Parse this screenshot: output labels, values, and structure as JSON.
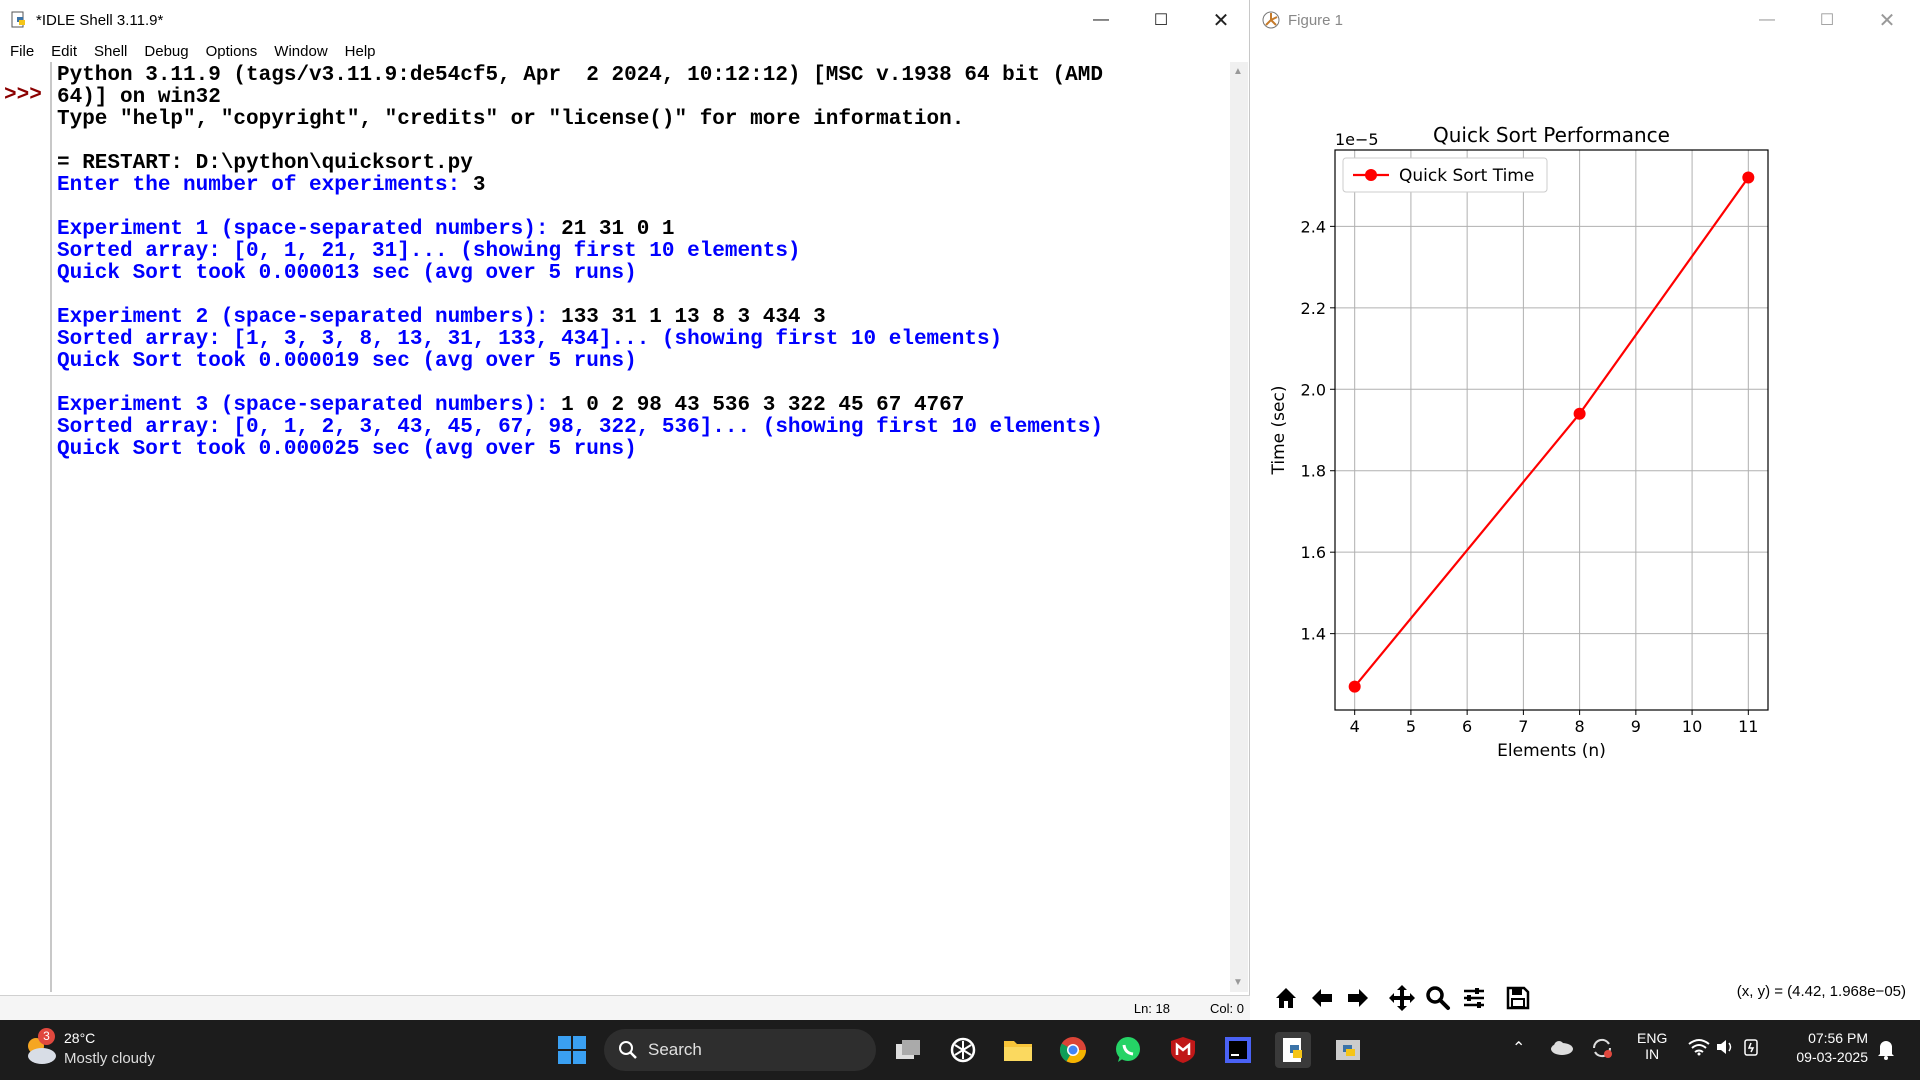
{
  "idle": {
    "title": "*IDLE Shell 3.11.9*",
    "menu": [
      "File",
      "Edit",
      "Shell",
      "Debug",
      "Options",
      "Window",
      "Help"
    ],
    "prompt": ">>>",
    "lines": [
      [
        {
          "t": "Python 3.11.9 (tags/v3.11.9:de54cf5, Apr  2 2024, 10:12:12) [MSC v.1938 64 bit (AMD",
          "c": "blk"
        }
      ],
      [
        {
          "t": "64)] on win32",
          "c": "blk"
        }
      ],
      [
        {
          "t": "Type \"help\", \"copyright\", \"credits\" or \"license()\" for more information.",
          "c": "blk"
        }
      ],
      [
        {
          "t": "",
          "c": "blk"
        }
      ],
      [
        {
          "t": "= RESTART: D:\\python\\quicksort.py",
          "c": "blk"
        }
      ],
      [
        {
          "t": "Enter the number of experiments: ",
          "c": "blue"
        },
        {
          "t": "3",
          "c": "blk"
        }
      ],
      [
        {
          "t": "",
          "c": "blk"
        }
      ],
      [
        {
          "t": "Experiment 1 (space-separated numbers): ",
          "c": "blue"
        },
        {
          "t": "21 31 0 1",
          "c": "blk"
        }
      ],
      [
        {
          "t": "Sorted array: [0, 1, 21, 31]... (showing first 10 elements)",
          "c": "blue"
        }
      ],
      [
        {
          "t": "Quick Sort took 0.000013 sec (avg over 5 runs)",
          "c": "blue"
        }
      ],
      [
        {
          "t": "",
          "c": "blk"
        }
      ],
      [
        {
          "t": "Experiment 2 (space-separated numbers): ",
          "c": "blue"
        },
        {
          "t": "133 31 1 13 8 3 434 3",
          "c": "blk"
        }
      ],
      [
        {
          "t": "Sorted array: [1, 3, 3, 8, 13, 31, 133, 434]... (showing first 10 elements)",
          "c": "blue"
        }
      ],
      [
        {
          "t": "Quick Sort took 0.000019 sec (avg over 5 runs)",
          "c": "blue"
        }
      ],
      [
        {
          "t": "",
          "c": "blk"
        }
      ],
      [
        {
          "t": "Experiment 3 (space-separated numbers): ",
          "c": "blue"
        },
        {
          "t": "1 0 2 98 43 536 3 322 45 67 4767",
          "c": "blk"
        }
      ],
      [
        {
          "t": "Sorted array: [0, 1, 2, 3, 43, 45, 67, 98, 322, 536]... (showing first 10 elements)",
          "c": "blue"
        }
      ],
      [
        {
          "t": "Quick Sort took 0.000025 sec (avg over 5 runs)",
          "c": "blue"
        }
      ]
    ],
    "status": {
      "ln": "Ln: 18",
      "col": "Col: 0"
    }
  },
  "figure": {
    "title": "Figure 1",
    "coords": "(x, y) = (4.42, 1.968e−05)",
    "toolbar": [
      "home-icon",
      "back-icon",
      "forward-icon",
      "pan-icon",
      "zoom-icon",
      "configure-icon",
      "save-icon"
    ]
  },
  "chart_data": {
    "type": "line",
    "title": "Quick Sort Performance",
    "xlabel": "Elements (n)",
    "ylabel": "Time (sec)",
    "offset_label": "1e−5",
    "x": [
      4,
      8,
      11
    ],
    "series": [
      {
        "name": "Quick Sort Time",
        "values": [
          1.27,
          1.94,
          2.52
        ],
        "color": "#ff0000"
      }
    ],
    "xlim": [
      3.65,
      11.35
    ],
    "ylim": [
      1.2125,
      2.5875
    ],
    "xticks": [
      4,
      5,
      6,
      7,
      8,
      9,
      10,
      11
    ],
    "yticks": [
      1.4,
      1.6,
      1.8,
      2.0,
      2.2,
      2.4
    ],
    "ytick_labels": [
      "1.4",
      "1.6",
      "1.8",
      "2.0",
      "2.2",
      "2.4"
    ],
    "grid": true,
    "legend": "upper-left"
  },
  "taskbar": {
    "weather_badge": "3",
    "temperature": "28°C",
    "condition": "Mostly cloudy",
    "search": "Search",
    "lang1": "ENG",
    "lang2": "IN",
    "time": "07:56 PM",
    "date": "09-03-2025"
  }
}
